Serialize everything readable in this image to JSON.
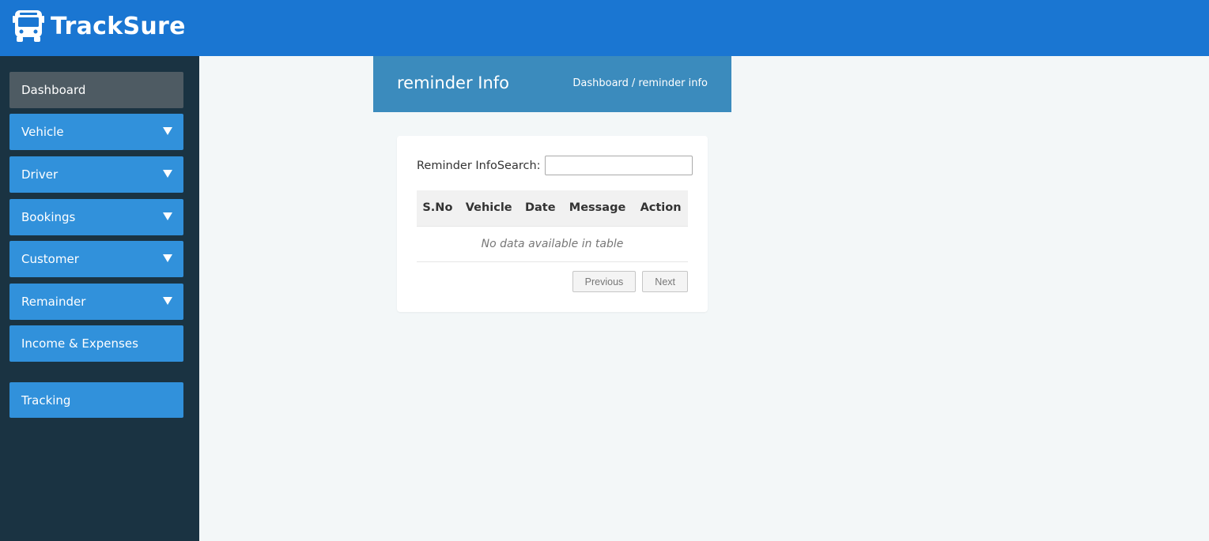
{
  "app": {
    "name": "TrackSure",
    "logo_icon": "bus-icon"
  },
  "colors": {
    "topbar": "#1a76d2",
    "sidebar": "#1a3342",
    "nav_item": "#3191db",
    "nav_active": "#4e5b63",
    "page_header": "#3b8bbd"
  },
  "sidebar": {
    "items": [
      {
        "label": "Dashboard",
        "active": true,
        "has_caret": false
      },
      {
        "label": "Vehicle",
        "has_caret": true
      },
      {
        "label": "Driver",
        "has_caret": true
      },
      {
        "label": "Bookings",
        "has_caret": true
      },
      {
        "label": "Customer",
        "has_caret": true
      },
      {
        "label": "Remainder",
        "has_caret": true
      },
      {
        "label": "Income & Expenses",
        "has_caret": false
      },
      {
        "label": "Tracking",
        "has_caret": false
      }
    ]
  },
  "header": {
    "title": "reminder Info",
    "breadcrumb": {
      "home": "Dashboard",
      "separator": "/",
      "current": "reminder info"
    }
  },
  "table": {
    "search_label": "Reminder InfoSearch:",
    "search_value": "",
    "columns": [
      "S.No",
      "Vehicle",
      "Date",
      "Message",
      "Action"
    ],
    "empty_message": "No data available in table",
    "pagination": {
      "previous": "Previous",
      "next": "Next"
    }
  }
}
